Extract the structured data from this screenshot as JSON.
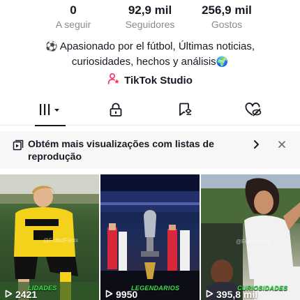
{
  "stats": [
    {
      "value": "0",
      "label": "A seguir"
    },
    {
      "value": "92,9 mil",
      "label": "Seguidores"
    },
    {
      "value": "256,9 mil",
      "label": "Gostos"
    }
  ],
  "bio": {
    "emoji_ball": "⚽",
    "text": "Apasionado por el fútbol, Últimas noticias, curiosidades, hechos y análisis",
    "emoji_globe": "🌍"
  },
  "studio": {
    "label": "TikTok Studio",
    "icon": "person-star-icon",
    "icon_color": "#fe2c55"
  },
  "tabs": [
    {
      "name": "videos",
      "icon": "grid-icon",
      "selected": true
    },
    {
      "name": "private",
      "icon": "lock-icon"
    },
    {
      "name": "reposts",
      "icon": "bookmark-repost-icon"
    },
    {
      "name": "liked",
      "icon": "heart-hidden-icon"
    }
  ],
  "banner": {
    "text": "Obtém mais visualizações com listas de reprodução",
    "icon": "playlist-icon"
  },
  "videos": [
    {
      "views": "2421",
      "caption": "LIDADES",
      "watermark": "@FutbolFacts"
    },
    {
      "views": "9950",
      "caption": "LEGENDARIOS",
      "watermark": ""
    },
    {
      "views": "395,8 mil",
      "caption": "CURIOSIDADES",
      "watermark": "@FutbolFacts"
    }
  ],
  "colors": {
    "text": "#161823",
    "muted": "#8a8b91",
    "accent": "#fe2c55",
    "caption_green": "#3fe34b"
  }
}
